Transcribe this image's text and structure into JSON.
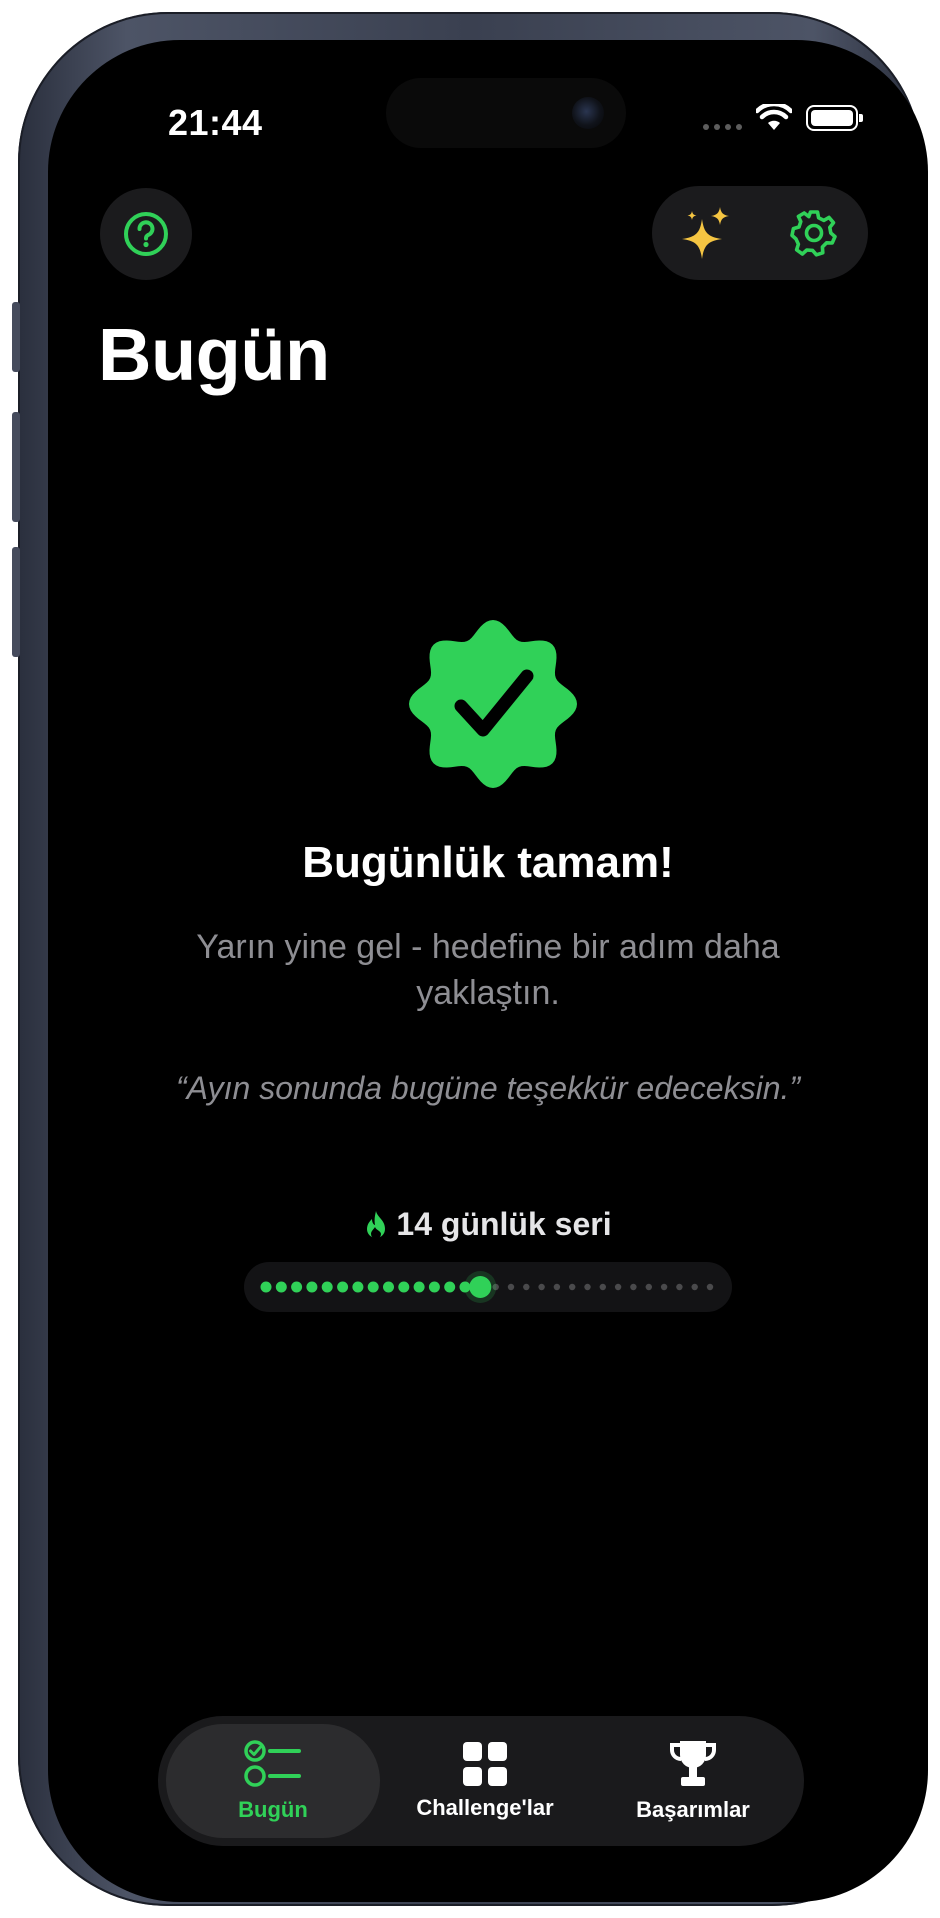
{
  "status_bar": {
    "time": "21:44"
  },
  "header": {
    "help_icon": "question-circle-icon",
    "sparkles_icon": "sparkles-icon",
    "settings_icon": "gear-icon",
    "title": "Bugün"
  },
  "completion": {
    "badge_icon": "checkmark-seal-icon",
    "title": "Bugünlük tamam!",
    "subtitle": "Yarın yine gel - hedefine bir adım daha yaklaştın.",
    "quote": "“Ayın sonunda bugüne teşekkür edeceksin.”"
  },
  "streak": {
    "icon": "flame-icon",
    "label": "14 günlük seri",
    "days_completed": 14,
    "days_total": 30
  },
  "tab_bar": {
    "tabs": [
      {
        "label": "Bugün",
        "icon": "checklist-icon",
        "active": true
      },
      {
        "label": "Challenge'lar",
        "icon": "grid-icon",
        "active": false
      },
      {
        "label": "Başarımlar",
        "icon": "trophy-icon",
        "active": false
      }
    ]
  },
  "colors": {
    "accent": "#30d158",
    "background": "#000000",
    "sparkle": "#f5c542",
    "secondary_text": "#8e8e93"
  }
}
